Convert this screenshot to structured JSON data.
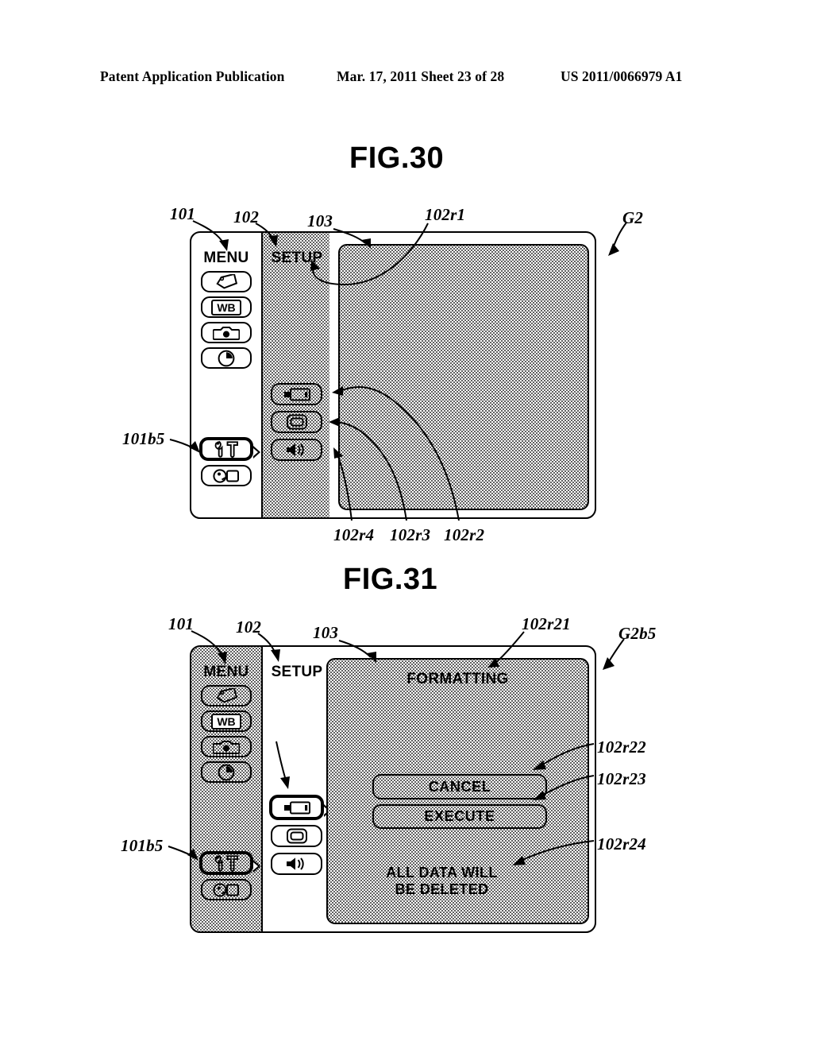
{
  "header": {
    "left": "Patent Application Publication",
    "middle": "Mar. 17, 2011  Sheet 23 of 28",
    "right": "US 2011/0066979 A1"
  },
  "figures": [
    {
      "id": "fig30",
      "title": "FIG.30",
      "screen_label": "G2",
      "menu": {
        "title": "MENU",
        "ref": "101",
        "selected_ref": "101b5",
        "items": [
          {
            "icon": "tag-icon",
            "selected": false
          },
          {
            "icon": "white-balance-icon",
            "label": "WB",
            "selected": false
          },
          {
            "icon": "camera-icon",
            "selected": false
          },
          {
            "icon": "clock-icon",
            "selected": false
          },
          {
            "icon": "tools-icon",
            "selected": true
          },
          {
            "icon": "playback-icon",
            "selected": false
          }
        ]
      },
      "setup": {
        "title": "SETUP",
        "ref": "102",
        "title_ref": "102r1",
        "items": [
          {
            "icon": "memory-card-icon",
            "ref": "102r2",
            "selected": false
          },
          {
            "icon": "monitor-icon",
            "ref": "102r3",
            "selected": false
          },
          {
            "icon": "speaker-icon",
            "ref": "102r4",
            "selected": false
          }
        ]
      },
      "content": {
        "ref": "103",
        "title": ""
      }
    },
    {
      "id": "fig31",
      "title": "FIG.31",
      "screen_label": "G2b5",
      "menu": {
        "title": "MENU",
        "ref": "101",
        "selected_ref": "101b5",
        "items": [
          {
            "icon": "tag-icon",
            "selected": false
          },
          {
            "icon": "white-balance-icon",
            "label": "WB",
            "selected": false
          },
          {
            "icon": "camera-icon",
            "selected": false
          },
          {
            "icon": "clock-icon",
            "selected": false
          },
          {
            "icon": "tools-icon",
            "selected": true
          },
          {
            "icon": "playback-icon",
            "selected": false
          }
        ]
      },
      "setup": {
        "title": "SETUP",
        "ref": "102",
        "selected_ref": "102r2",
        "items": [
          {
            "icon": "memory-card-icon",
            "selected": true
          },
          {
            "icon": "monitor-icon",
            "selected": false
          },
          {
            "icon": "speaker-icon",
            "selected": false
          }
        ]
      },
      "content": {
        "ref": "103",
        "title": "FORMATTING",
        "title_ref": "102r21",
        "buttons": [
          {
            "label": "CANCEL",
            "ref": "102r22",
            "selected": true
          },
          {
            "label": "EXECUTE",
            "ref": "102r23",
            "selected": false
          }
        ],
        "warning": "ALL DATA WILL\nBE DELETED",
        "warning_ref": "102r24"
      }
    }
  ]
}
